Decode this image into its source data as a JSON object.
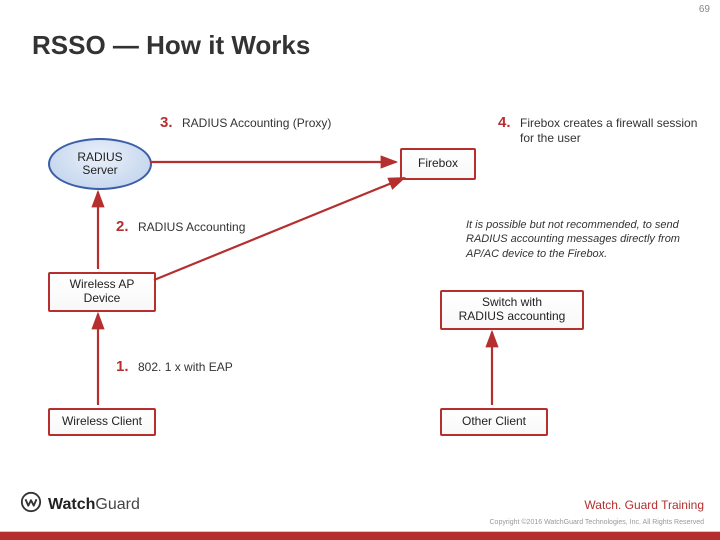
{
  "page_number": "69",
  "title": "RSSO — How it Works",
  "nodes": {
    "radius_server": "RADIUS\nServer",
    "firebox": "Firebox",
    "wireless_ap": "Wireless AP\nDevice",
    "switch": "Switch with\nRADIUS accounting",
    "wireless_client": "Wireless Client",
    "other_client": "Other Client"
  },
  "steps": {
    "s1_num": "1.",
    "s1_txt": "802. 1 x with EAP",
    "s2_num": "2.",
    "s2_txt": "RADIUS Accounting",
    "s3_num": "3.",
    "s3_txt": "RADIUS Accounting (Proxy)",
    "s4_num": "4.",
    "s4_txt": "Firebox creates a firewall session for the user"
  },
  "note": "It is possible but not recommended, to send RADIUS accounting messages directly from AP/AC device to the Firebox.",
  "footer": {
    "brand_a": "Watch",
    "brand_b": "Guard",
    "training": "Watch. Guard Training",
    "copyright": "Copyright ©2016 WatchGuard Technologies, Inc. All Rights Reserved"
  },
  "colors": {
    "accent_red": "#b52f2f",
    "node_blue": "#3b5ea9"
  }
}
